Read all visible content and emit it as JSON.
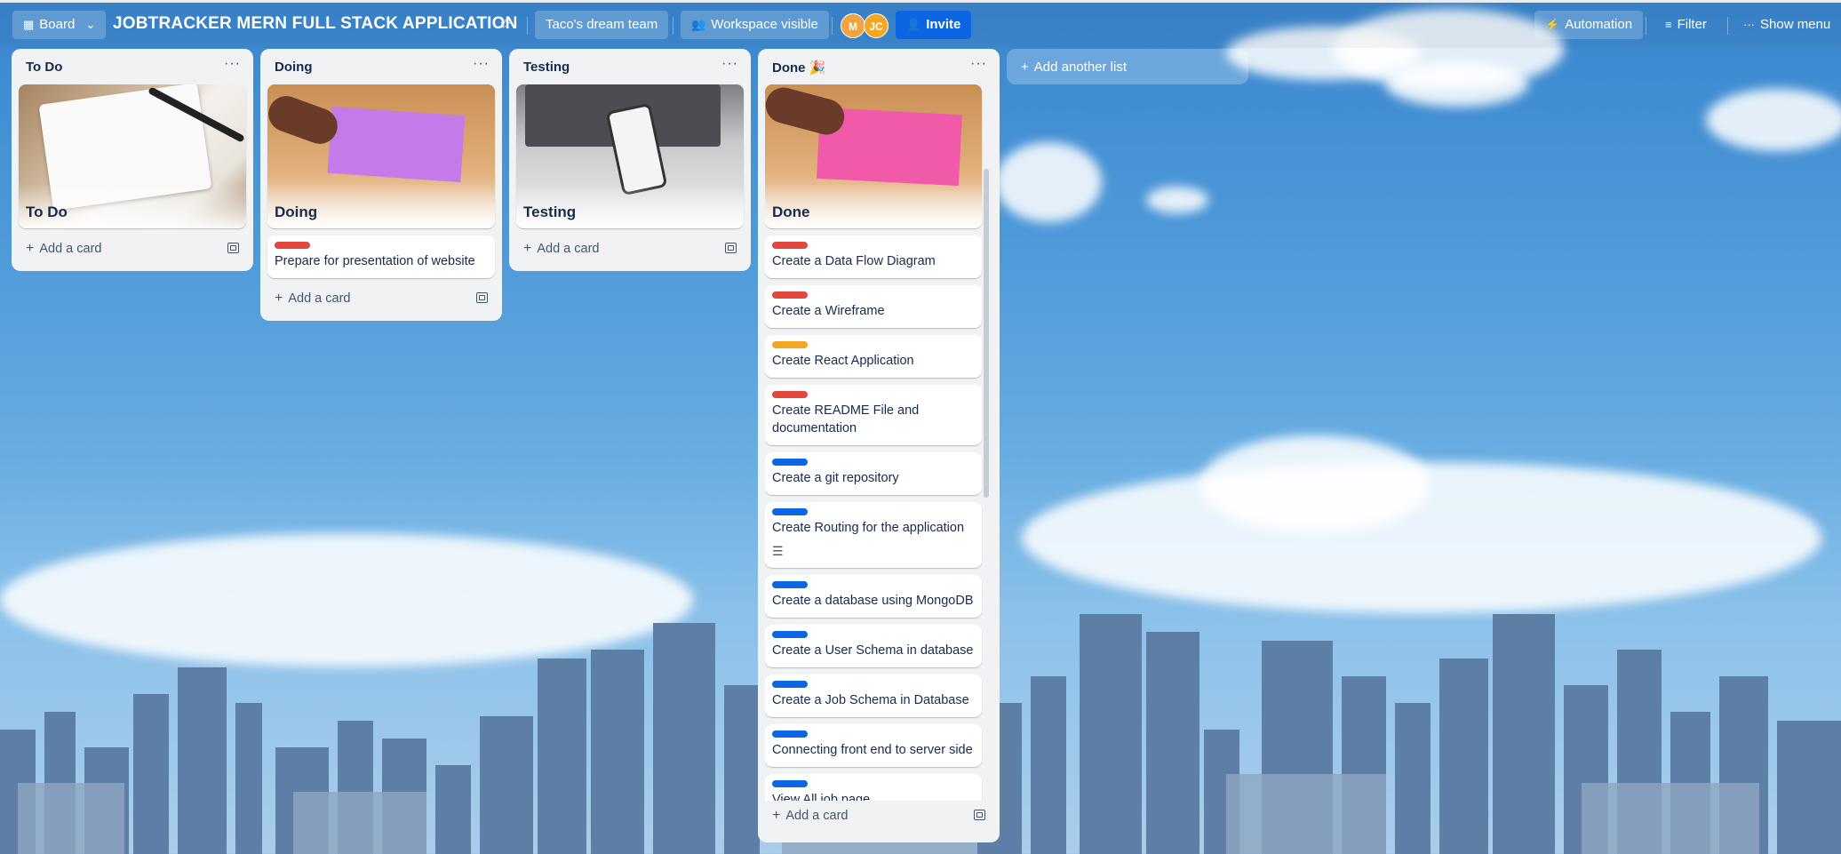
{
  "header": {
    "view_label": "Board",
    "board_title": "JOBTRACKER MERN FULL STACK APPLICATION",
    "workspace": "Taco's dream team",
    "visibility": "Workspace visible",
    "members": [
      "M",
      "JC"
    ],
    "invite_label": "Invite",
    "automation_label": "Automation",
    "filter_label": "Filter",
    "menu_label": "Show menu"
  },
  "lists": [
    {
      "title": "To Do",
      "cover_title": "To Do",
      "cards": [],
      "add_label": "Add a card"
    },
    {
      "title": "Doing",
      "cover_title": "Doing",
      "cards": [
        {
          "title": "Prepare for presentation of website",
          "label_color": "#e2483d"
        }
      ],
      "add_label": "Add a card"
    },
    {
      "title": "Testing",
      "cover_title": "Testing",
      "cards": [],
      "add_label": "Add a card"
    },
    {
      "title": "Done 🎉",
      "cover_title": "Done",
      "cards": [
        {
          "title": "Create a Data Flow Diagram",
          "label_color": "#e2483d"
        },
        {
          "title": "Create a Wireframe",
          "label_color": "#e2483d"
        },
        {
          "title": "Create React Application",
          "label_color": "#f5a623"
        },
        {
          "title": "Create README File and documentation",
          "label_color": "#e2483d"
        },
        {
          "title": "Create a git repository",
          "label_color": "#0c66e4"
        },
        {
          "title": "Create Routing for the application",
          "label_color": "#0c66e4",
          "has_description": true
        },
        {
          "title": "Create a database using MongoDB",
          "label_color": "#0c66e4"
        },
        {
          "title": "Create a User Schema in database",
          "label_color": "#0c66e4"
        },
        {
          "title": "Create a Job Schema in Database",
          "label_color": "#0c66e4"
        },
        {
          "title": "Connecting front end to server side",
          "label_color": "#0c66e4"
        },
        {
          "title": "View All job page",
          "label_color": "#0c66e4"
        },
        {
          "title": "",
          "label_color": "#c963d6"
        }
      ],
      "add_label": "Add a card"
    }
  ],
  "add_list_label": "Add another list",
  "icons": {
    "board": "board-icon",
    "chevron": "chevron-down-icon",
    "star": "star-icon",
    "visibility": "people-icon",
    "invite": "person-add-icon",
    "automation": "lightning-icon",
    "filter": "filter-icon",
    "menu": "more-icon",
    "card_template": "card-template-icon",
    "description": "description-icon",
    "plus": "plus-icon"
  }
}
